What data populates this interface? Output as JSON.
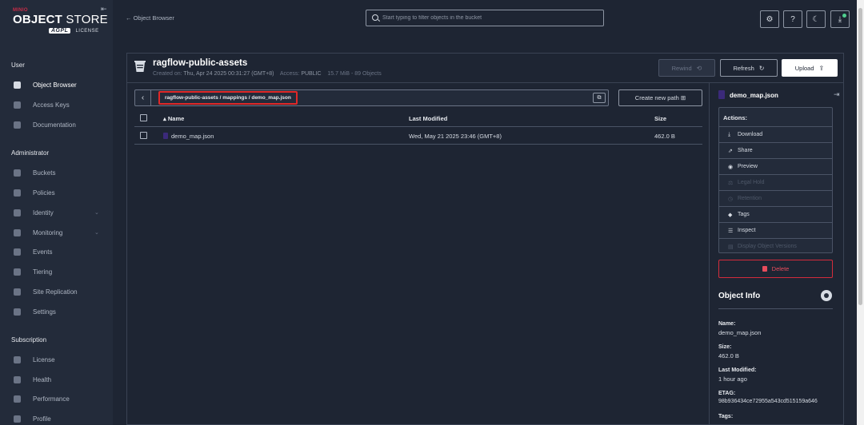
{
  "sidebar": {
    "logo": {
      "brand": "MINIO",
      "title_bold": "OBJECT",
      "title_rest": " STORE",
      "agpl": "AGPL",
      "license": "LICENSE"
    },
    "sections": [
      {
        "title": "User"
      },
      {
        "title": "Administrator"
      },
      {
        "title": "Subscription"
      }
    ],
    "user_items": [
      {
        "label": "Object Browser"
      },
      {
        "label": "Access Keys"
      },
      {
        "label": "Documentation"
      }
    ],
    "admin_items": [
      {
        "label": "Buckets"
      },
      {
        "label": "Policies"
      },
      {
        "label": "Identity"
      },
      {
        "label": "Monitoring"
      },
      {
        "label": "Events"
      },
      {
        "label": "Tiering"
      },
      {
        "label": "Site Replication"
      },
      {
        "label": "Settings"
      }
    ],
    "sub_items": [
      {
        "label": "License"
      },
      {
        "label": "Health"
      },
      {
        "label": "Performance"
      },
      {
        "label": "Profile"
      }
    ]
  },
  "topbar": {
    "back_label": "← Object Browser",
    "search_placeholder": "Start typing to filter objects in the bucket"
  },
  "bucket": {
    "name": "ragflow-public-assets",
    "created_label": "Created on: ",
    "created_value": "Thu, Apr 24 2025 00:31:27 (GMT+8)",
    "access_label": "Access: ",
    "access_value": "PUBLIC",
    "stats": "15.7 MiB - 89 Objects",
    "rewind_label": "Rewind",
    "refresh_label": "Refresh",
    "upload_label": "Upload"
  },
  "breadcrumb": {
    "path": "ragflow-public-assets / mappings / demo_map.json",
    "new_path_label": "Create new path"
  },
  "table": {
    "headers": {
      "name": "Name",
      "modified": "Last Modified",
      "size": "Size"
    },
    "rows": [
      {
        "name": "demo_map.json",
        "modified": "Wed, May 21 2025 23:46 (GMT+8)",
        "size": "462.0 B"
      }
    ]
  },
  "panel": {
    "file_name": "demo_map.json",
    "actions_title": "Actions:",
    "actions": [
      {
        "label": "Download"
      },
      {
        "label": "Share"
      },
      {
        "label": "Preview"
      },
      {
        "label": "Legal Hold"
      },
      {
        "label": "Retention"
      },
      {
        "label": "Tags"
      },
      {
        "label": "Inspect"
      },
      {
        "label": "Display Object Versions"
      }
    ],
    "delete_label": "Delete",
    "info_title": "Object Info",
    "info": [
      {
        "key": "Name:",
        "value": "demo_map.json"
      },
      {
        "key": "Size:",
        "value": "462.0 B"
      },
      {
        "key": "Last Modified:",
        "value": "1 hour ago"
      },
      {
        "key": "ETAG:",
        "value": "98b936434ce72955a543cd515159a646"
      },
      {
        "key": "Tags:",
        "value": ""
      }
    ]
  }
}
